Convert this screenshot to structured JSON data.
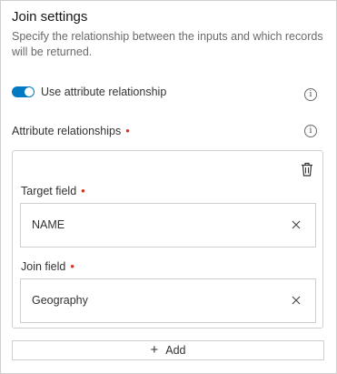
{
  "panel": {
    "title": "Join settings",
    "description": "Specify the relationship between the inputs and which records will be returned."
  },
  "toggle": {
    "label": "Use attribute relationship",
    "checked": true,
    "accent": "#007ac2"
  },
  "attribute_relationships": {
    "label": "Attribute relationships",
    "required_marker": "•",
    "required_color": "#d83020",
    "target_field": {
      "label": "Target field",
      "value": "NAME"
    },
    "join_field": {
      "label": "Join field",
      "value": "Geography"
    }
  },
  "icons": {
    "info": "info-icon",
    "delete": "trash-icon",
    "clear": "close-icon",
    "add": "plus-icon",
    "info_glyph": "i"
  },
  "add_button": {
    "label": "Add",
    "glyph": "+"
  }
}
